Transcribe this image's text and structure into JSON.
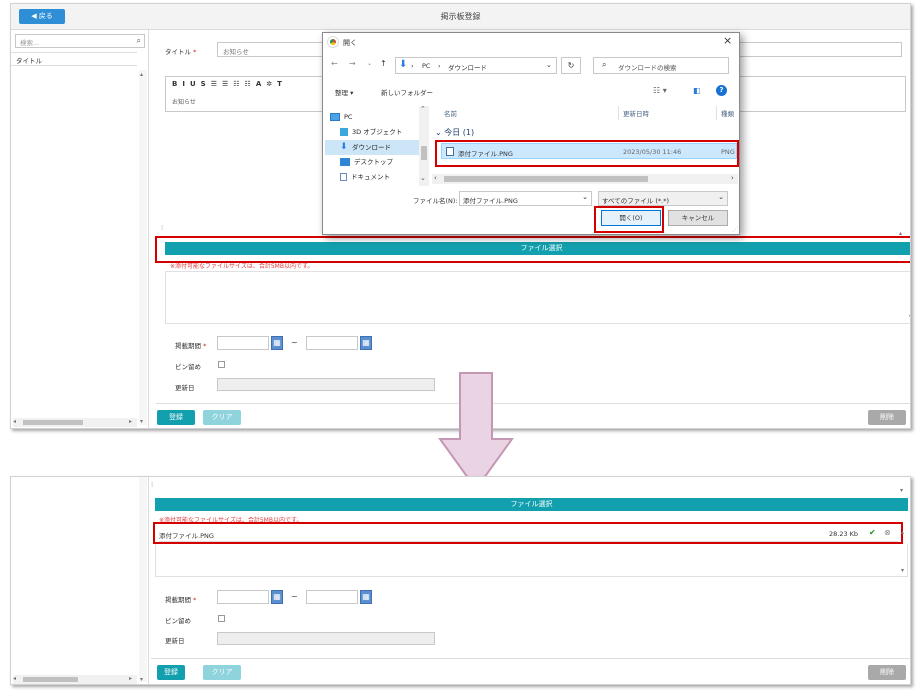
{
  "top": {
    "back_label": "戻る",
    "page_title": "掲示板登録",
    "sidebar": {
      "search_placeholder": "検索...",
      "list_header": "タイトル"
    },
    "form": {
      "title_label": "タイトル",
      "required_mark": "*",
      "title_value": "お知らせ",
      "toolbar_items": [
        "B",
        "I",
        "U",
        "S",
        "☰",
        "☰",
        "☷",
        "☷",
        "A",
        "✲",
        "T"
      ],
      "editor_text": "お知らせ",
      "file_select_label": "ファイル選択",
      "file_note": "※添付可能なファイルサイズは、合計5MB以内です。",
      "period_label": "掲載期間",
      "period_sep": "~",
      "pin_label": "ピン留め",
      "updated_label": "更新日"
    },
    "buttons": {
      "register": "登録",
      "clear": "クリア",
      "delete": "削除"
    }
  },
  "dialog": {
    "title": "開く",
    "path": [
      "PC",
      "ダウンロード"
    ],
    "search_placeholder": "ダウンロードの検索",
    "organize": "整理",
    "new_folder": "新しいフォルダー",
    "tree": [
      "PC",
      "3D オブジェクト",
      "ダウンロード",
      "デスクトップ",
      "ドキュメント"
    ],
    "columns": {
      "name": "名前",
      "modified": "更新日時",
      "type": "種類"
    },
    "group_label": "今日 (1)",
    "file": {
      "name": "添付ファイル.PNG",
      "modified": "2023/05/30 11:46",
      "type": "PNG"
    },
    "filename_label": "ファイル名(N):",
    "filename_value": "添付ファイル.PNG",
    "filter_value": "すべてのファイル (*.*)",
    "open_button": "開く(O)",
    "cancel_button": "キャンセル"
  },
  "bottom": {
    "file_select_label": "ファイル選択",
    "file_note": "※添付可能なファイルサイズは、合計5MB以内です。",
    "attached_file": {
      "name": "添付ファイル.PNG",
      "size": "28.23 Kb"
    },
    "period_label": "掲載期間",
    "required_mark": "*",
    "period_sep": "~",
    "pin_label": "ピン留め",
    "updated_label": "更新日",
    "buttons": {
      "register": "登録",
      "clear": "クリア",
      "delete": "削除"
    }
  },
  "colors": {
    "teal": "#13a0ae",
    "blue": "#2e8fd6",
    "highlight_red": "#d40000",
    "arrow_fill": "#ead3e2",
    "arrow_stroke": "#c498b4"
  }
}
